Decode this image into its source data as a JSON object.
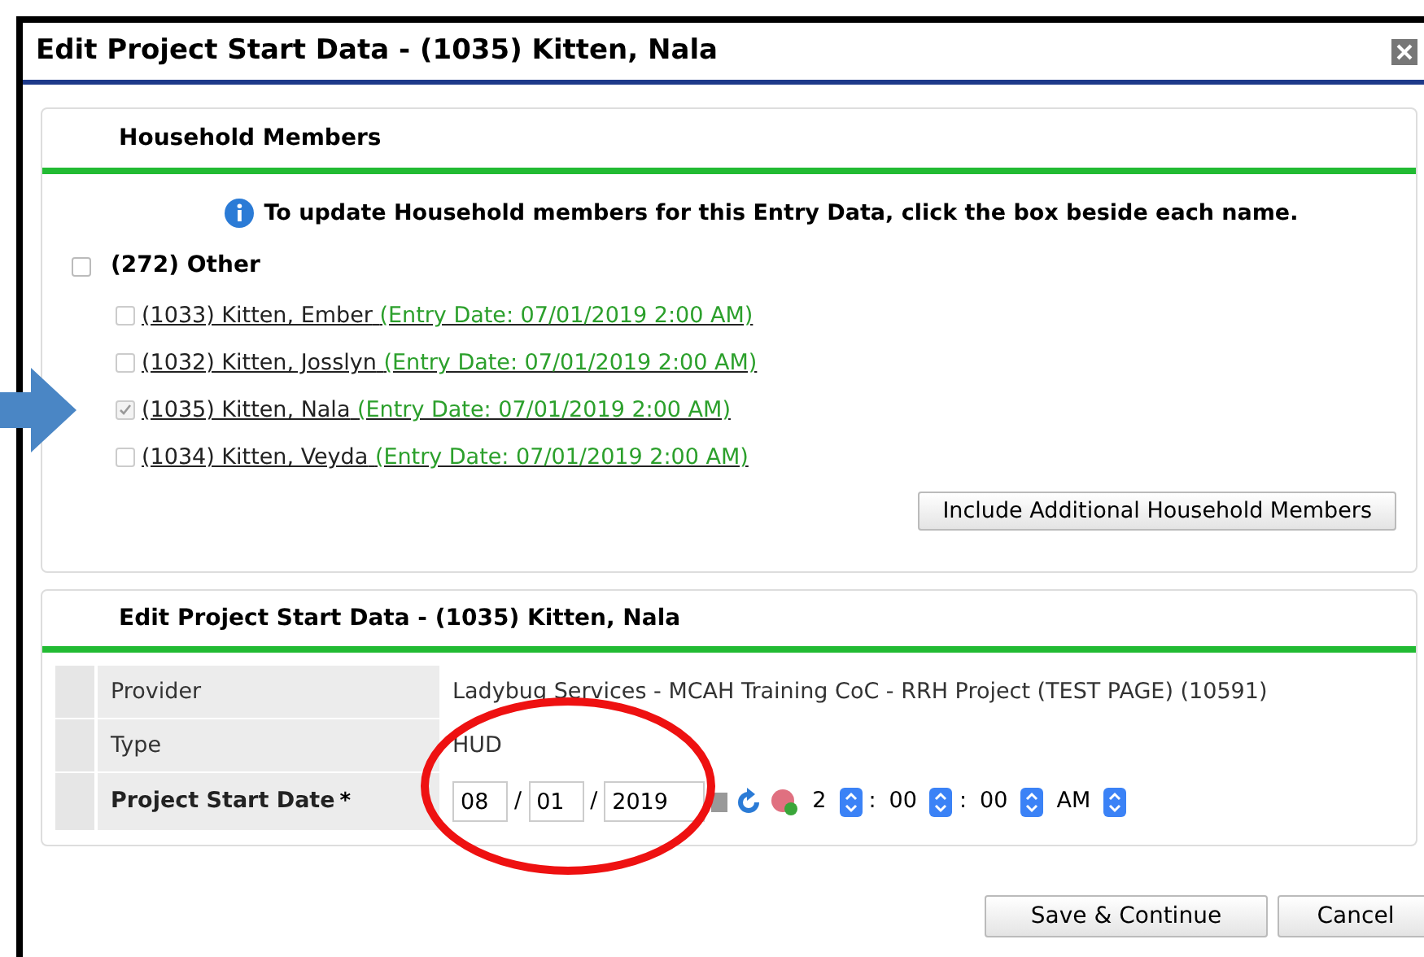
{
  "window": {
    "title": "Edit Project Start Data - (1035) Kitten, Nala"
  },
  "household": {
    "title": "Household Members",
    "info": "To update Household members for this Entry Data, click the box beside each name.",
    "group": {
      "label": "(272) Other",
      "checked": false
    },
    "members": [
      {
        "name": "(1033) Kitten, Ember",
        "entry": "(Entry Date: 07/01/2019 2:00 AM)",
        "checked": false,
        "pointed": false
      },
      {
        "name": "(1032) Kitten, Josslyn",
        "entry": "(Entry Date: 07/01/2019 2:00 AM)",
        "checked": false,
        "pointed": false
      },
      {
        "name": "(1035) Kitten, Nala",
        "entry": "(Entry Date: 07/01/2019 2:00 AM)",
        "checked": true,
        "pointed": true
      },
      {
        "name": "(1034) Kitten, Veyda",
        "entry": "(Entry Date: 07/01/2019 2:00 AM)",
        "checked": false,
        "pointed": false
      }
    ],
    "include_button": "Include Additional Household Members"
  },
  "start": {
    "title": "Edit Project Start Data - (1035) Kitten, Nala",
    "rows": [
      {
        "label": "Provider",
        "value": "Ladybug Services - MCAH Training CoC - RRH Project (TEST PAGE) (10591)"
      },
      {
        "label": "Type",
        "value": "HUD"
      }
    ],
    "date_label": "Project Start Date",
    "required": "*",
    "date": {
      "month": "08",
      "day": "01",
      "year": "2019"
    },
    "date_separators": [
      "/",
      "/"
    ],
    "time": [
      {
        "value": "2"
      },
      {
        "value": "00",
        "sep": ":"
      },
      {
        "value": "00",
        "sep": ":"
      },
      {
        "value": "AM"
      }
    ]
  },
  "buttons": [
    "Save & Continue",
    "Cancel"
  ]
}
